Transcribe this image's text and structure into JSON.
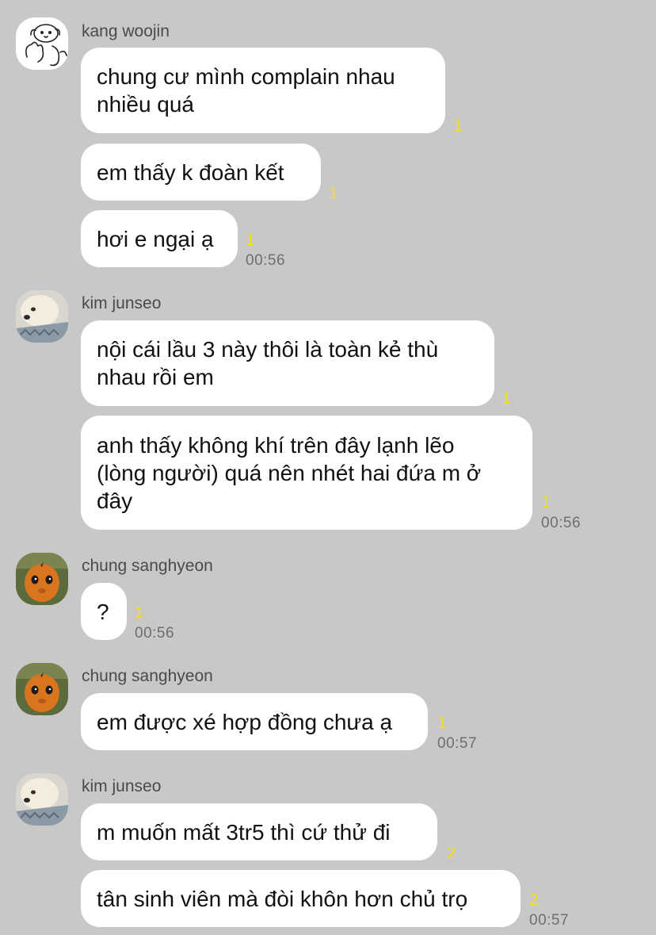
{
  "groups": [
    {
      "sender": "kang woojin",
      "avatar": "dog-sketch-avatar",
      "messages": [
        {
          "text": "chung cư mình complain nhau\nnhiều quá",
          "read_count": "1"
        },
        {
          "text": "em thấy k đoàn kết",
          "read_count": "1"
        },
        {
          "text": "hơi e ngại ạ",
          "read_count": "1",
          "time": "00:56"
        }
      ]
    },
    {
      "sender": "kim junseo",
      "avatar": "fluffy-dog-avatar",
      "messages": [
        {
          "text": "nội cái lầu 3 này thôi là toàn kẻ thù\nnhau rồi em",
          "read_count": "1"
        },
        {
          "text": "anh thấy không khí trên đây lạnh lẽo\n(lòng người) quá nên nhét hai đứa m ở\nđây",
          "read_count": "1",
          "time": "00:56"
        }
      ]
    },
    {
      "sender": "chung sanghyeon",
      "avatar": "orange-character-avatar",
      "messages": [
        {
          "text": "?",
          "read_count": "1",
          "time": "00:56"
        }
      ]
    },
    {
      "sender": "chung sanghyeon",
      "avatar": "orange-character-avatar",
      "messages": [
        {
          "text": "em được xé hợp đồng chưa ạ",
          "read_count": "1",
          "time": "00:57"
        }
      ]
    },
    {
      "sender": "kim junseo",
      "avatar": "fluffy-dog-avatar",
      "messages": [
        {
          "text": "m muốn mất 3tr5 thì cứ thử đi",
          "read_count": "2"
        },
        {
          "text": "tân sinh viên mà đòi khôn hơn chủ trọ",
          "read_count": "2",
          "time": "00:57"
        }
      ]
    }
  ]
}
